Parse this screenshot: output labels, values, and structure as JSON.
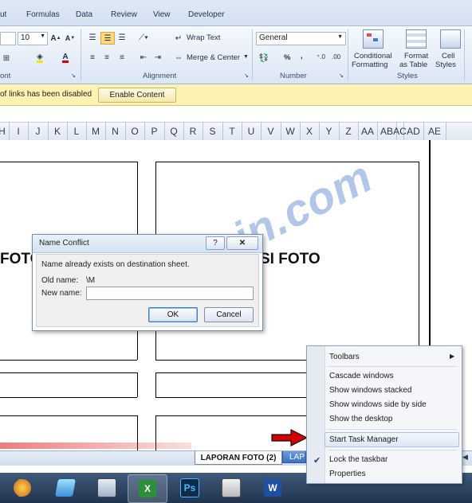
{
  "ribbon": {
    "tabs": [
      "ut",
      "Formulas",
      "Data",
      "Review",
      "View",
      "Developer"
    ],
    "font": {
      "size": "10",
      "group_label": "ont"
    },
    "alignment": {
      "wrap_text": "Wrap Text",
      "merge_center": "Merge & Center",
      "group_label": "Alignment"
    },
    "number": {
      "format": "General",
      "percent": "%",
      "comma": ",",
      "group_label": "Number"
    },
    "styles": {
      "conditional_line1": "Conditional",
      "conditional_line2": "Formatting",
      "format_line1": "Format",
      "format_line2": "as Table",
      "cell_line1": "Cell",
      "cell_line2": "Styles",
      "group_label": "Styles"
    }
  },
  "message_bar": {
    "text": "of links has been disabled",
    "button": "Enable Content"
  },
  "columns": [
    "H",
    "I",
    "J",
    "K",
    "L",
    "M",
    "N",
    "O",
    "P",
    "Q",
    "R",
    "S",
    "T",
    "U",
    "V",
    "W",
    "X",
    "Y",
    "Z",
    "AA",
    "AB",
    "AC",
    "AD",
    "AE"
  ],
  "sheet": {
    "left_title": "FOTO",
    "right_title": "SI FOTO"
  },
  "dialog": {
    "title": "Name Conflict",
    "help": "?",
    "message": "Name already exists on destination sheet.",
    "old_name_label": "Old name:",
    "old_name_value": "\\M",
    "new_name_label": "New name:",
    "new_name_value": "",
    "ok": "OK",
    "cancel": "Cancel"
  },
  "context_menu": {
    "toolbars": "Toolbars",
    "cascade": "Cascade windows",
    "stacked": "Show windows stacked",
    "side_by_side": "Show windows side by side",
    "desktop": "Show the desktop",
    "task_manager": "Start Task Manager",
    "lock": "Lock the taskbar",
    "properties": "Properties"
  },
  "sheet_tabs": {
    "active": "LAPORAN FOTO (2)",
    "next": "LAP"
  },
  "watermark": "ITPoin.com",
  "taskbar": {
    "ps": "Ps",
    "word": "W",
    "excel": "X"
  },
  "colors": {
    "accent": "#3b66b0",
    "arrow": "#d40000",
    "msgbar": "#fcf2b2"
  }
}
